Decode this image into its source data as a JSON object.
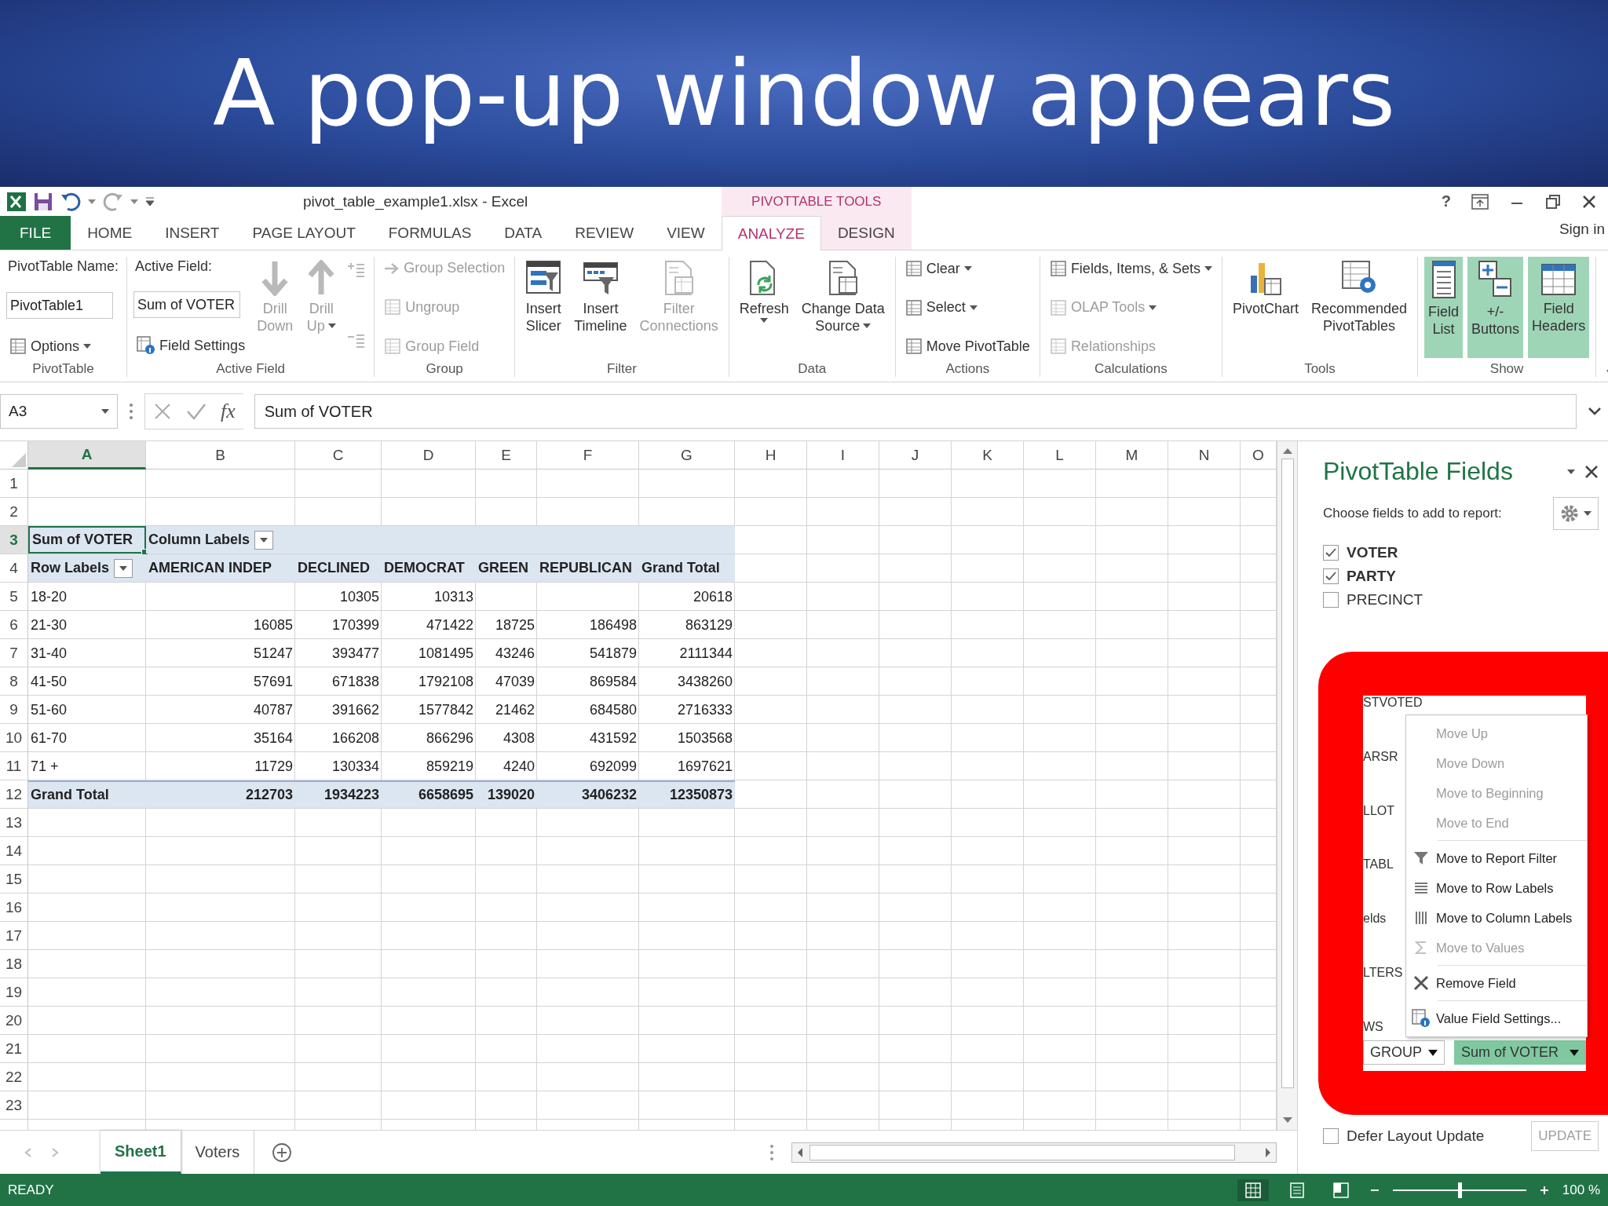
{
  "slide": {
    "title": "A pop-up window appears"
  },
  "window": {
    "title": "pivot_table_example1.xlsx - Excel",
    "context_label": "PIVOTTABLE TOOLS",
    "help": "?",
    "account": "Sign in"
  },
  "tabs": [
    {
      "label": "FILE",
      "kind": "file",
      "contextual": false,
      "selected": false
    },
    {
      "label": "HOME",
      "kind": "tab",
      "contextual": false,
      "selected": false
    },
    {
      "label": "INSERT",
      "kind": "tab",
      "contextual": false,
      "selected": false
    },
    {
      "label": "PAGE LAYOUT",
      "kind": "tab",
      "contextual": false,
      "selected": false
    },
    {
      "label": "FORMULAS",
      "kind": "tab",
      "contextual": false,
      "selected": false
    },
    {
      "label": "DATA",
      "kind": "tab",
      "contextual": false,
      "selected": false
    },
    {
      "label": "REVIEW",
      "kind": "tab",
      "contextual": false,
      "selected": false
    },
    {
      "label": "VIEW",
      "kind": "tab",
      "contextual": false,
      "selected": false
    },
    {
      "label": "ANALYZE",
      "kind": "tab",
      "contextual": true,
      "selected": true
    },
    {
      "label": "DESIGN",
      "kind": "tab",
      "contextual": true,
      "selected": false
    }
  ],
  "ribbon": {
    "groups": [
      {
        "name": "PivotTable",
        "columns": [
          [
            {
              "kind": "label",
              "label": "PivotTable Name:"
            },
            {
              "kind": "field",
              "value": "PivotTable1"
            },
            {
              "kind": "small",
              "label": "Options",
              "dropdown": true,
              "disabled": false
            }
          ]
        ]
      },
      {
        "name": "Active Field",
        "columns": [
          [
            {
              "kind": "label",
              "label": "Active Field:"
            },
            {
              "kind": "field",
              "value": "Sum of VOTER"
            },
            {
              "kind": "small",
              "label": "Field Settings",
              "dropdown": false,
              "disabled": false
            }
          ],
          [
            {
              "kind": "large",
              "lines": [
                "Drill",
                "Down"
              ],
              "dropdown": false,
              "disabled": true,
              "on": false
            }
          ],
          [
            {
              "kind": "large",
              "lines": [
                "Drill",
                "Up"
              ],
              "dropdown": true,
              "disabled": true,
              "on": false
            }
          ],
          [
            {
              "kind": "icon",
              "disabled": true
            },
            {
              "kind": "icon",
              "disabled": true
            }
          ]
        ]
      },
      {
        "name": "Group",
        "columns": [
          [
            {
              "kind": "small",
              "label": "Group Selection",
              "dropdown": false,
              "disabled": true
            },
            {
              "kind": "small",
              "label": "Ungroup",
              "dropdown": false,
              "disabled": true
            },
            {
              "kind": "small",
              "label": "Group Field",
              "dropdown": false,
              "disabled": true
            }
          ]
        ]
      },
      {
        "name": "Filter",
        "columns": [
          [
            {
              "kind": "large",
              "lines": [
                "Insert",
                "Slicer"
              ],
              "dropdown": false,
              "disabled": false,
              "on": false
            }
          ],
          [
            {
              "kind": "large",
              "lines": [
                "Insert",
                "Timeline"
              ],
              "dropdown": false,
              "disabled": false,
              "on": false
            }
          ],
          [
            {
              "kind": "large",
              "lines": [
                "Filter",
                "Connections"
              ],
              "dropdown": false,
              "disabled": true,
              "on": false
            }
          ]
        ]
      },
      {
        "name": "Data",
        "columns": [
          [
            {
              "kind": "large",
              "lines": [
                "Refresh"
              ],
              "dropdown": true,
              "disabled": false,
              "on": false
            }
          ],
          [
            {
              "kind": "large",
              "lines": [
                "Change Data",
                "Source"
              ],
              "dropdown": true,
              "disabled": false,
              "on": false
            }
          ]
        ]
      },
      {
        "name": "Actions",
        "columns": [
          [
            {
              "kind": "small",
              "label": "Clear",
              "dropdown": true,
              "disabled": false
            },
            {
              "kind": "small",
              "label": "Select",
              "dropdown": true,
              "disabled": false
            },
            {
              "kind": "small",
              "label": "Move PivotTable",
              "dropdown": false,
              "disabled": false
            }
          ]
        ]
      },
      {
        "name": "Calculations",
        "columns": [
          [
            {
              "kind": "small",
              "label": "Fields, Items, & Sets",
              "dropdown": true,
              "disabled": false
            },
            {
              "kind": "small",
              "label": "OLAP Tools",
              "dropdown": true,
              "disabled": true
            },
            {
              "kind": "small",
              "label": "Relationships",
              "dropdown": false,
              "disabled": true
            }
          ]
        ]
      },
      {
        "name": "Tools",
        "columns": [
          [
            {
              "kind": "large",
              "lines": [
                "PivotChart"
              ],
              "dropdown": false,
              "disabled": false,
              "on": false
            }
          ],
          [
            {
              "kind": "large",
              "lines": [
                "Recommended",
                "PivotTables"
              ],
              "dropdown": false,
              "disabled": false,
              "on": false
            }
          ]
        ]
      },
      {
        "name": "Show",
        "columns": [
          [
            {
              "kind": "large",
              "lines": [
                "Field",
                "List"
              ],
              "dropdown": false,
              "disabled": false,
              "on": true
            }
          ],
          [
            {
              "kind": "large",
              "lines": [
                "+/-",
                "Buttons"
              ],
              "dropdown": false,
              "disabled": false,
              "on": true
            }
          ],
          [
            {
              "kind": "large",
              "lines": [
                "Field",
                "Headers"
              ],
              "dropdown": false,
              "disabled": false,
              "on": true
            }
          ]
        ]
      }
    ]
  },
  "formula_bar": {
    "cell": "A3",
    "function_label": "fx",
    "value": "Sum of VOTER"
  },
  "sheet": {
    "columns": [
      {
        "label": "A",
        "selected": true
      },
      {
        "label": "B",
        "selected": false
      },
      {
        "label": "C",
        "selected": false
      },
      {
        "label": "D",
        "selected": false
      },
      {
        "label": "E",
        "selected": false
      },
      {
        "label": "F",
        "selected": false
      },
      {
        "label": "G",
        "selected": false
      },
      {
        "label": "H",
        "selected": false
      },
      {
        "label": "I",
        "selected": false
      },
      {
        "label": "J",
        "selected": false
      },
      {
        "label": "K",
        "selected": false
      },
      {
        "label": "L",
        "selected": false
      },
      {
        "label": "M",
        "selected": false
      },
      {
        "label": "N",
        "selected": false
      },
      {
        "label": "O",
        "selected": false
      }
    ],
    "rows": [
      {
        "label": "1",
        "selected": false
      },
      {
        "label": "2",
        "selected": false
      },
      {
        "label": "3",
        "selected": true
      },
      {
        "label": "4",
        "selected": false
      },
      {
        "label": "5",
        "selected": false
      },
      {
        "label": "6",
        "selected": false
      },
      {
        "label": "7",
        "selected": false
      },
      {
        "label": "8",
        "selected": false
      },
      {
        "label": "9",
        "selected": false
      },
      {
        "label": "10",
        "selected": false
      },
      {
        "label": "11",
        "selected": false
      },
      {
        "label": "12",
        "selected": false
      },
      {
        "label": "13",
        "selected": false
      },
      {
        "label": "14",
        "selected": false
      },
      {
        "label": "15",
        "selected": false
      },
      {
        "label": "16",
        "selected": false
      },
      {
        "label": "17",
        "selected": false
      },
      {
        "label": "18",
        "selected": false
      },
      {
        "label": "19",
        "selected": false
      },
      {
        "label": "20",
        "selected": false
      },
      {
        "label": "21",
        "selected": false
      },
      {
        "label": "22",
        "selected": false
      },
      {
        "label": "23",
        "selected": false
      }
    ]
  },
  "pivot": {
    "value_field": "Sum of VOTER",
    "column_labels": "Column Labels",
    "row_labels": "Row Labels",
    "columns": [
      "AMERICAN INDEP",
      "DECLINED",
      "DEMOCRAT",
      "GREEN",
      "REPUBLICAN",
      "Grand Total"
    ],
    "rows": [
      {
        "label": "18-20",
        "cells": [
          {},
          {
            "value": "10305"
          },
          {
            "value": "10313"
          },
          {},
          {},
          {
            "value": "20618"
          }
        ]
      },
      {
        "label": "21-30",
        "cells": [
          {
            "value": "16085"
          },
          {
            "value": "170399"
          },
          {
            "value": "471422"
          },
          {
            "value": "18725"
          },
          {
            "value": "186498"
          },
          {
            "value": "863129"
          }
        ]
      },
      {
        "label": "31-40",
        "cells": [
          {
            "value": "51247"
          },
          {
            "value": "393477"
          },
          {
            "value": "1081495"
          },
          {
            "value": "43246"
          },
          {
            "value": "541879"
          },
          {
            "value": "2111344"
          }
        ]
      },
      {
        "label": "41-50",
        "cells": [
          {
            "value": "57691"
          },
          {
            "value": "671838"
          },
          {
            "value": "1792108"
          },
          {
            "value": "47039"
          },
          {
            "value": "869584"
          },
          {
            "value": "3438260"
          }
        ]
      },
      {
        "label": "51-60",
        "cells": [
          {
            "value": "40787"
          },
          {
            "value": "391662"
          },
          {
            "value": "1577842"
          },
          {
            "value": "21462"
          },
          {
            "value": "684580"
          },
          {
            "value": "2716333"
          }
        ]
      },
      {
        "label": "61-70",
        "cells": [
          {
            "value": "35164"
          },
          {
            "value": "166208"
          },
          {
            "value": "866296"
          },
          {
            "value": "4308"
          },
          {
            "value": "431592"
          },
          {
            "value": "1503568"
          }
        ]
      },
      {
        "label": "71 +",
        "cells": [
          {
            "value": "11729"
          },
          {
            "value": "130334"
          },
          {
            "value": "859219"
          },
          {
            "value": "4240"
          },
          {
            "value": "692099"
          },
          {
            "value": "1697621"
          }
        ]
      }
    ],
    "total": {
      "label": "Grand Total",
      "cells": [
        {
          "value": "212703"
        },
        {
          "value": "1934223"
        },
        {
          "value": "6658695"
        },
        {
          "value": "139020"
        },
        {
          "value": "3406232"
        },
        {
          "value": "12350873"
        }
      ]
    }
  },
  "sheet_tabs": [
    {
      "label": "Sheet1",
      "selected": true
    },
    {
      "label": "Voters",
      "selected": false
    }
  ],
  "panel": {
    "title": "PivotTable Fields",
    "hint": "Choose fields to add to report:",
    "fields": [
      {
        "label": "VOTER",
        "checked": true
      },
      {
        "label": "PARTY",
        "checked": true
      },
      {
        "label": "PRECINCT",
        "checked": false
      }
    ],
    "hidden_fragments": [
      "STVOTED",
      "ARSR",
      "LLOT",
      "TABL",
      "elds",
      "LTERS",
      "WS"
    ],
    "areas": [
      {
        "label": "GROUP",
        "selected": false
      },
      {
        "label": "Sum of VOTER",
        "selected": true
      }
    ],
    "context_menu": {
      "sections": [
        [
          {
            "label": "Move Up",
            "disabled": true
          },
          {
            "label": "Move Down",
            "disabled": true
          },
          {
            "label": "Move to Beginning",
            "disabled": true
          },
          {
            "label": "Move to End",
            "disabled": true
          }
        ],
        [
          {
            "label": "Move to Report Filter",
            "disabled": false
          },
          {
            "label": "Move to Row Labels",
            "disabled": false
          },
          {
            "label": "Move to Column Labels",
            "disabled": false
          },
          {
            "label": "Move to Values",
            "disabled": true
          }
        ],
        [
          {
            "label": "Remove Field",
            "disabled": false
          }
        ],
        [
          {
            "label": "Value Field Settings...",
            "disabled": false
          }
        ]
      ]
    },
    "defer": {
      "label": "Defer Layout Update",
      "checked": false
    },
    "update": {
      "label": "UPDATE",
      "disabled": true
    }
  },
  "status_bar": {
    "status": "READY",
    "views": [
      {
        "selected": true
      },
      {
        "selected": false
      },
      {
        "selected": false
      }
    ],
    "zoom": {
      "level": 0.5,
      "reading": "100 %"
    }
  }
}
